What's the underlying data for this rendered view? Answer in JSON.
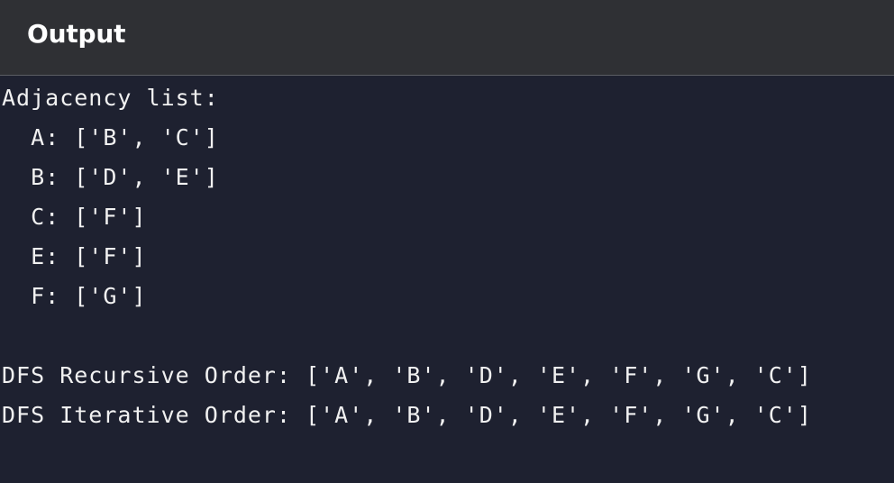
{
  "header": {
    "title": "Output"
  },
  "console": {
    "lines": [
      "Adjacency list:",
      "  A: ['B', 'C']",
      "  B: ['D', 'E']",
      "  C: ['F']",
      "  E: ['F']",
      "  F: ['G']",
      "",
      "DFS Recursive Order: ['A', 'B', 'D', 'E', 'F', 'G', 'C']",
      "DFS Iterative Order: ['A', 'B', 'D', 'E', 'F', 'G', 'C']"
    ]
  },
  "colors": {
    "header_bg": "#2f3034",
    "console_bg": "#1e2130",
    "text": "#f1f1f1"
  }
}
